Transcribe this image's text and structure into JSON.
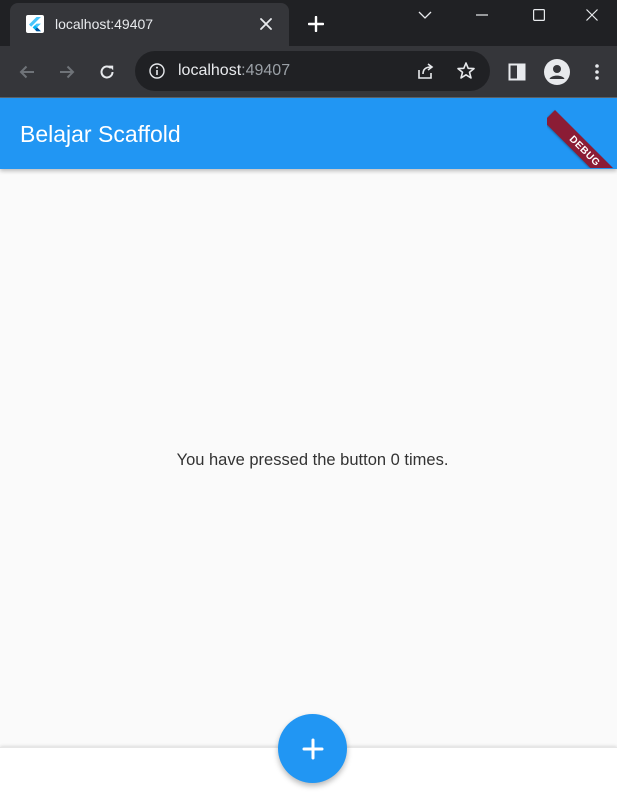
{
  "browser": {
    "tab": {
      "title": "localhost:49407",
      "favicon": "flutter-logo-icon"
    },
    "address_bar": {
      "host": "localhost",
      "port": ":49407"
    },
    "icons": {
      "back": "arrow-left-icon",
      "forward": "arrow-right-icon",
      "reload": "reload-icon",
      "info": "info-icon",
      "share": "share-icon",
      "bookmark": "star-icon",
      "side_panel": "side-panel-icon",
      "profile": "profile-icon",
      "menu": "kebab-menu-icon"
    }
  },
  "app": {
    "appbar_title": "Belajar Scaffold",
    "debug_banner": "DEBUG",
    "counter_text": "You have pressed the button 0 times.",
    "fab_icon": "plus-icon",
    "colors": {
      "primary": "#2196f3",
      "debug_banner": "#8b1c35",
      "background": "#fafafa"
    }
  }
}
